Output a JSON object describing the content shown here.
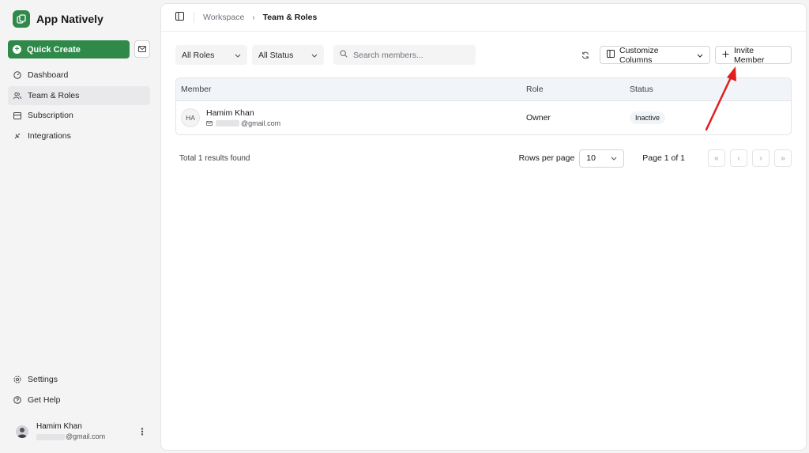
{
  "app": {
    "name": "App Natively"
  },
  "sidebar": {
    "quick_create": "Quick Create",
    "items": [
      {
        "label": "Dashboard",
        "icon": "gauge-icon"
      },
      {
        "label": "Team & Roles",
        "icon": "users-icon",
        "active": true
      },
      {
        "label": "Subscription",
        "icon": "credit-card-icon"
      },
      {
        "label": "Integrations",
        "icon": "plug-icon"
      }
    ],
    "bottom_items": [
      {
        "label": "Settings",
        "icon": "gear-icon"
      },
      {
        "label": "Get Help",
        "icon": "help-circle-icon"
      }
    ],
    "user": {
      "name": "Hamim Khan",
      "email": "@gmail.com"
    }
  },
  "breadcrumb": {
    "parent": "Workspace",
    "current": "Team & Roles"
  },
  "toolbar": {
    "roles_filter": "All Roles",
    "status_filter": "All Status",
    "search_placeholder": "Search members...",
    "customize_columns": "Customize Columns",
    "invite_member": "Invite Member"
  },
  "table": {
    "headers": [
      "Member",
      "Role",
      "Status"
    ],
    "rows": [
      {
        "initials": "HA",
        "name": "Hamim Khan",
        "email": "@gmail.com",
        "role": "Owner",
        "status": "Inactive"
      }
    ]
  },
  "footer": {
    "total": "Total 1 results found",
    "rows_per_page_label": "Rows per page",
    "rows_per_page": "10",
    "page": "Page 1 of 1"
  },
  "colors": {
    "brand": "#2f8a4a",
    "annotation_arrow": "#e11d1d"
  }
}
